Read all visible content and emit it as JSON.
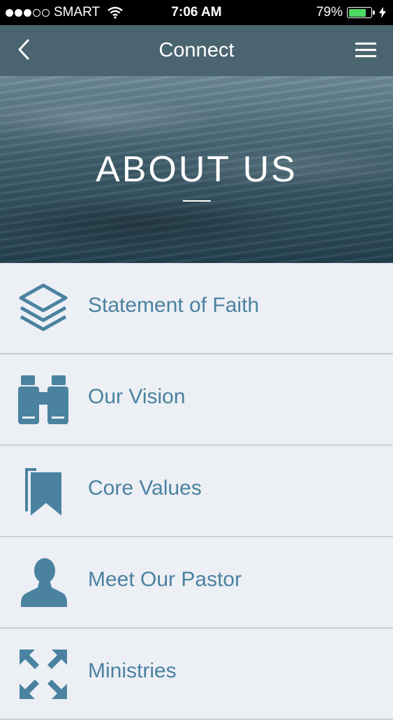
{
  "status_bar": {
    "carrier": "SMART",
    "time": "7:06 AM",
    "battery_percent": "79%",
    "battery_level": 0.79
  },
  "nav": {
    "title": "Connect"
  },
  "hero": {
    "heading": "ABOUT US"
  },
  "menu_items": [
    {
      "label": "Statement of Faith",
      "icon": "layers-icon"
    },
    {
      "label": "Our Vision",
      "icon": "binoculars-icon"
    },
    {
      "label": "Core Values",
      "icon": "bookmark-icon"
    },
    {
      "label": "Meet Our Pastor",
      "icon": "person-icon"
    },
    {
      "label": "Ministries",
      "icon": "expand-arrows-icon"
    }
  ],
  "colors": {
    "nav_bar": "#4b6570",
    "accent": "#4a82a0",
    "list_background": "#eceff4"
  }
}
